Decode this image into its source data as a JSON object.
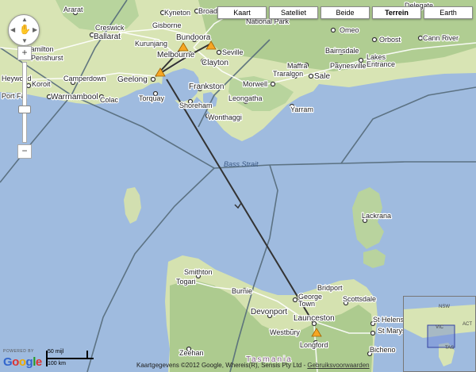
{
  "map_types": [
    "Kaart",
    "Satelliet",
    "Beide",
    "Terrein",
    "Earth"
  ],
  "map_types_active": "Terrein",
  "zoom": {
    "in": "+",
    "out": "−"
  },
  "nav": {
    "north": "▲",
    "south": "▼",
    "west": "◀",
    "east": "▶",
    "hand": "✋"
  },
  "cities": {
    "ararat": "Ararat",
    "kyneton": "Kyneton",
    "broadford": "Broadf",
    "creswick": "Creswick",
    "gisborne": "Gisborne",
    "bundoora": "Bundoora",
    "ballarat": "Ballarat",
    "kurunjang": "Kurunjang",
    "melbourne": "Melbourne",
    "seville": "Seville",
    "clayton": "Clayton",
    "hamilton": "Hamilton",
    "penshurst": "Penshurst",
    "heywood": "Heywood",
    "camperdown": "Camperdown",
    "geelong": "Geelong",
    "koroit": "Koroit",
    "portfairy": "Port Fai",
    "warrnambool": "Warrnambool",
    "colac": "Colac",
    "torquay": "Torquay",
    "frankston": "Frankston",
    "shoreham": "Shoreham",
    "wonthaggi": "Wonthaggi",
    "leongatha": "Leongatha",
    "morwell": "Morwell",
    "traralgon": "Traralgon",
    "sale": "Sale",
    "maffra": "Maffra",
    "yarram": "Yarram",
    "paynesville": "Paynesville",
    "lakes_entrance": "Lakes\nEntrance",
    "bairnsdale": "Bairnsdale",
    "orbost": "Orbost",
    "cann_river": "Cann River",
    "omeo": "Omeo",
    "national_park": "National Park",
    "delegate": "Delegate",
    "smithton": "Smithton",
    "togari": "Togari",
    "burnie": "Burnie",
    "devonport": "Devonport",
    "george_town": "George\nTown",
    "bridport": "Bridport",
    "scottsdale": "Scottsdale",
    "launceston": "Launceston",
    "westbury": "Westbury",
    "longford": "Longford",
    "st_helens": "St Helens",
    "st_marys": "St Marys",
    "bicheno": "Bicheno",
    "zeehan": "Zeehan",
    "lackrana": "Lackrana"
  },
  "state_label": "Tasmania",
  "water_label": "Bass Strait",
  "overview": {
    "nsw": "NSW",
    "vic": "VIC",
    "act": "ACT",
    "tas": "TAS"
  },
  "scale": {
    "miles": "50 mijl",
    "km": "100 km"
  },
  "attribution": {
    "text": "Kaartgegevens ©2012 Google, Whereis(R), Sensis Pty Ltd -",
    "terms": "Gebruiksvoorwaarden"
  },
  "powered_by": "POWERED BY",
  "logo": [
    "G",
    "o",
    "o",
    "g",
    "l",
    "e"
  ],
  "colors": {
    "sea": "#9fbbdf",
    "land": "#d5e2b0",
    "forest": "#a8c98b",
    "route": "#333333",
    "marker": "#f6a623",
    "border": "#556b7a"
  },
  "route_markers": [
    "warning-marker-geelong",
    "warning-marker-melbourne",
    "warning-marker-seville",
    "warning-marker-launceston"
  ]
}
